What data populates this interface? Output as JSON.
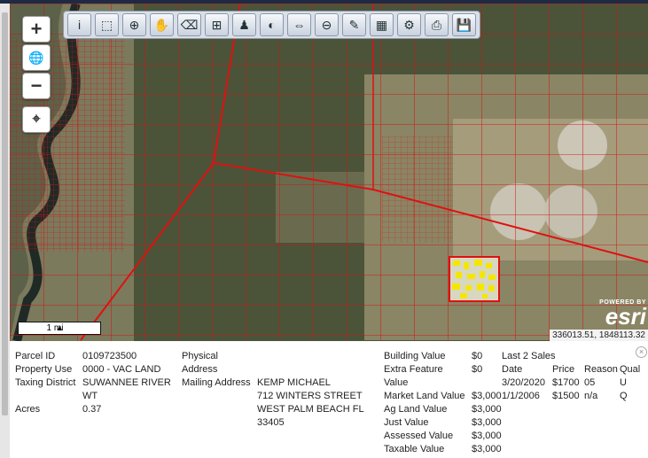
{
  "toolbar": {
    "tools": [
      "identify-icon",
      "select-icon",
      "zoom-in-box-icon",
      "pan-hand-icon",
      "eraser-icon",
      "select-area-icon",
      "person-icon",
      "layers-icon",
      "measure-icon",
      "zoom-out-icon",
      "pencil-icon",
      "map-print-icon",
      "settings-icon",
      "printer-icon",
      "save-icon"
    ],
    "glyphs": [
      "i",
      "⬚",
      "⊕",
      "✋",
      "⌫",
      "⊞",
      "♟",
      "◐",
      "⇔",
      "⊖",
      "✎",
      "▦",
      "⚙",
      "⎙",
      "💾"
    ]
  },
  "zoom": {
    "in_label": "+",
    "globe_label": "🌐",
    "out_label": "−",
    "locate_label": "⌖"
  },
  "map": {
    "scale_label": "1 mi",
    "coords": "336013.51, 1848113.32",
    "attribution_powered": "POWERED BY",
    "attribution_name": "esri",
    "parcel_color": "#e01010",
    "highlight_color": "#f5e600"
  },
  "parcel": {
    "col1_labels": [
      "Parcel ID",
      "Property Use",
      "Taxing District",
      "",
      "Acres"
    ],
    "col1_values": [
      "0109723500",
      "0000 - VAC LAND",
      "SUWANNEE RIVER",
      "WT",
      "0.37"
    ],
    "col2_labels": [
      "Physical",
      "Address",
      "Mailing Address"
    ],
    "mailing": [
      "KEMP MICHAEL",
      "712 WINTERS STREET",
      "WEST PALM BEACH FL",
      "33405"
    ],
    "value_labels": [
      "Building Value",
      "Extra Feature",
      "Value",
      "Market Land Value",
      "Ag Land Value",
      "Just Value",
      "Assessed Value",
      "Taxable Value"
    ],
    "value_values": [
      "$0",
      "$0",
      "",
      "$3,000",
      "$3,000",
      "$3,000",
      "$3,000",
      "$3,000"
    ],
    "sales_title": "Last 2 Sales",
    "sales_headers": [
      "Date",
      "Price",
      "Reason",
      "Qual"
    ],
    "sales": [
      [
        "3/20/2020",
        "$1700",
        "05",
        "U"
      ],
      [
        "1/1/2006",
        "$1500",
        "n/a",
        "Q"
      ]
    ]
  }
}
